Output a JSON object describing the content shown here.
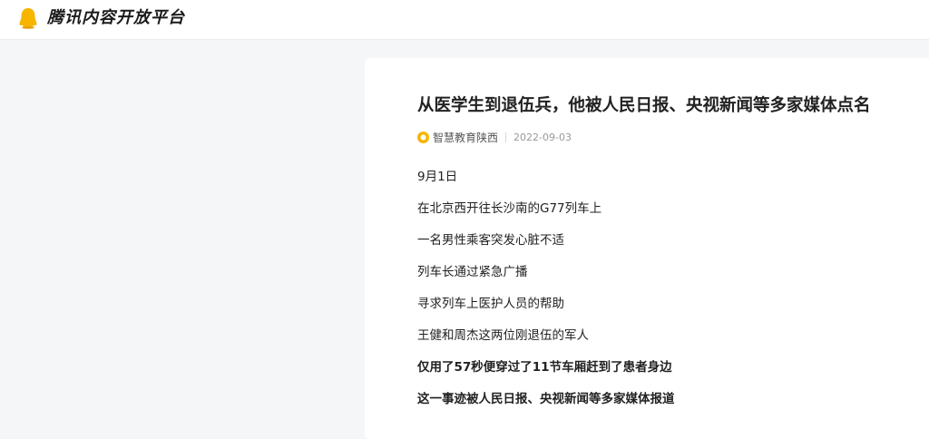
{
  "header": {
    "site_title": "腾讯内容开放平台",
    "logo_icon": "penguin-logo-icon",
    "brand_color": "#f7b500"
  },
  "article": {
    "title": "从医学生到退伍兵，他被人民日报、央视新闻等多家媒体点名",
    "author": "智慧教育陕西",
    "date": "2022-09-03",
    "paragraphs": [
      {
        "text": "9月1日",
        "bold": false
      },
      {
        "text": "在北京西开往长沙南的G77列车上",
        "bold": false
      },
      {
        "text": "一名男性乘客突发心脏不适",
        "bold": false
      },
      {
        "text": "列车长通过紧急广播",
        "bold": false
      },
      {
        "text": "寻求列车上医护人员的帮助",
        "bold": false
      },
      {
        "text": "王健和周杰这两位刚退伍的军人",
        "bold": false
      },
      {
        "text": "仅用了57秒便穿过了11节车厢赶到了患者身边",
        "bold": true
      },
      {
        "text": "这一事迹被人民日报、央视新闻等多家媒体报道",
        "bold": true
      }
    ]
  }
}
